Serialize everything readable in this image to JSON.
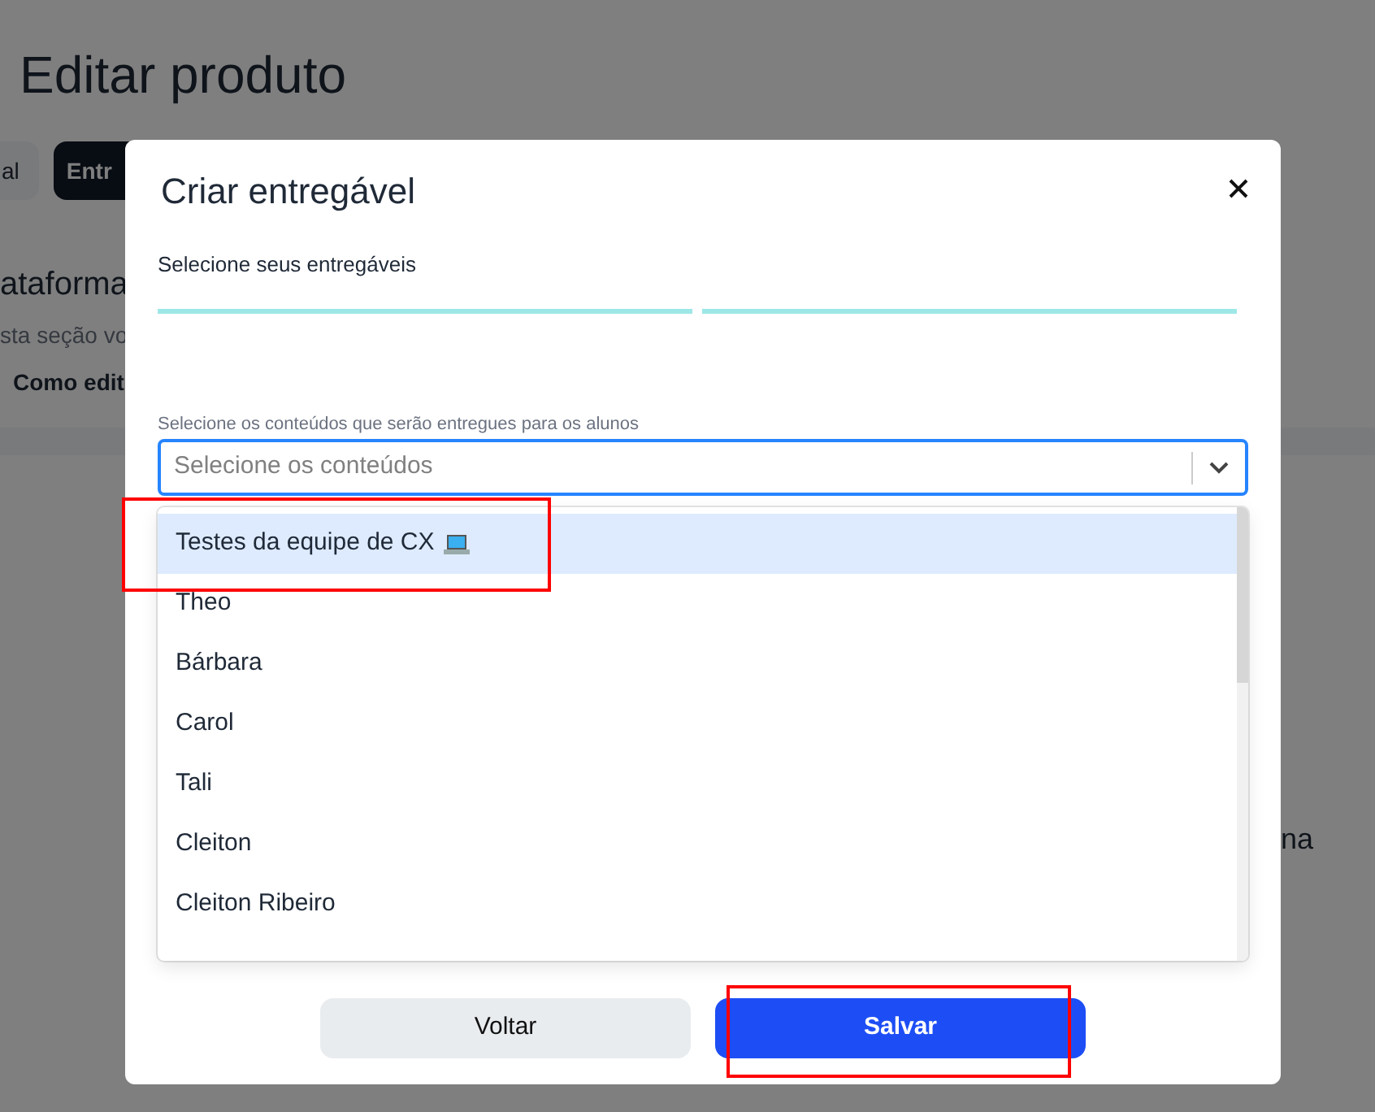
{
  "page": {
    "title": "Editar produto",
    "tabs": [
      {
        "label": "al",
        "selected": false
      },
      {
        "label": "Entr",
        "selected": true
      }
    ],
    "section_title": "ataforma",
    "section_text": "sta seção vo",
    "help_link": "Como edit",
    "side_text": "na"
  },
  "modal": {
    "title": "Criar entregável",
    "subtitle": "Selecione seus entregáveis",
    "steps": [
      {
        "level": 1
      },
      {
        "level": 1
      }
    ],
    "select": {
      "label": "Selecione os conteúdos que serão entregues para os alunos",
      "placeholder": "Selecione os conteúdos"
    },
    "options": [
      {
        "label": "Testes da equipe de CX",
        "kind": "with-icon",
        "selected": true
      },
      {
        "label": "Theo",
        "selected": false
      },
      {
        "label": "Bárbara",
        "selected": false
      },
      {
        "label": "Carol",
        "selected": false
      },
      {
        "label": "Tali",
        "selected": false
      },
      {
        "label": "Cleiton",
        "selected": false
      },
      {
        "label": "Cleiton Ribeiro",
        "selected": false
      }
    ],
    "buttons": [
      {
        "label": "Voltar",
        "kind": "secondary"
      },
      {
        "label": "Salvar",
        "kind": "primary"
      }
    ]
  }
}
